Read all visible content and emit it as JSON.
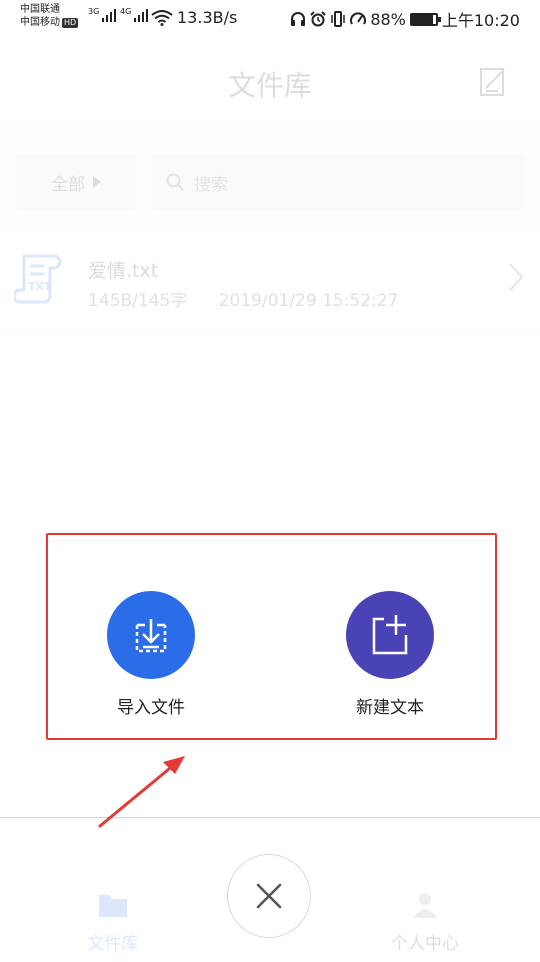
{
  "status_bar": {
    "carrier_1": "中国联通",
    "carrier_2": "中国移动",
    "hd_badge": "HD",
    "network_1": "3G",
    "network_2": "4G",
    "net_speed": "13.3B/s",
    "battery": "88%",
    "battery_level": 0.88,
    "time": "上午10:20",
    "icons": [
      "headphones-icon",
      "alarm-icon",
      "vibrate-icon",
      "speed-icon",
      "wifi-icon",
      "battery-icon"
    ]
  },
  "header": {
    "title": "文件库",
    "edit_icon": "edit-icon"
  },
  "filter": {
    "category": "全部",
    "search_placeholder": "搜索"
  },
  "files": [
    {
      "name": "爱情.txt",
      "size": "145B/145字",
      "date": "2019/01/29 15:52:27",
      "icon": "txt-file-icon"
    }
  ],
  "actions": {
    "import": {
      "label": "导入文件",
      "icon": "import-icon",
      "color": "#2b6de8"
    },
    "new_text": {
      "label": "新建文本",
      "icon": "new-doc-icon",
      "color": "#4a43b5"
    }
  },
  "tabs": [
    {
      "label": "文件库",
      "icon": "folder-icon",
      "color": "#2b6de8"
    },
    {
      "label": "个人中心",
      "icon": "person-icon"
    }
  ],
  "annotation_color": "#e53935"
}
